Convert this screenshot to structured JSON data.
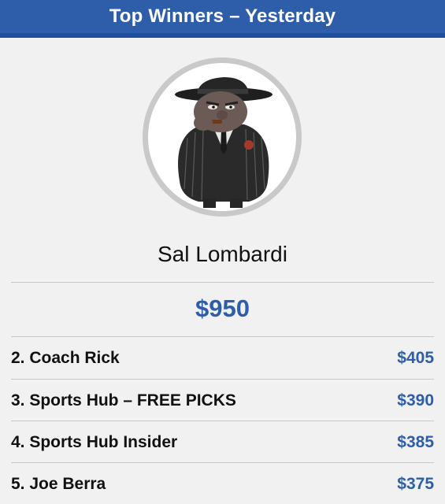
{
  "header": {
    "title": "Top Winners – Yesterday"
  },
  "winner": {
    "name": "Sal Lombardi",
    "amount": "$950",
    "avatar_icon": "cartoon-gangster-avatar"
  },
  "rankings": [
    {
      "label": "2. Coach Rick",
      "amount": "$405"
    },
    {
      "label": "3. Sports Hub – FREE PICKS",
      "amount": "$390"
    },
    {
      "label": "4. Sports Hub Insider",
      "amount": "$385"
    },
    {
      "label": "5. Joe Berra",
      "amount": "$375"
    }
  ],
  "colors": {
    "header_bg": "#2e5ea9",
    "accent": "#2e5ea9",
    "background": "#f1f1f1"
  }
}
